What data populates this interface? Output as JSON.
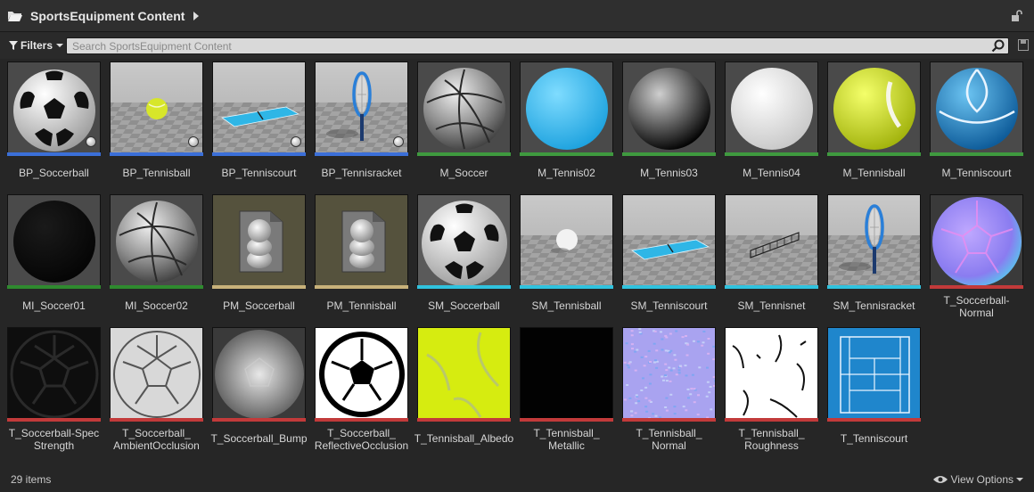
{
  "header": {
    "title": "SportsEquipment Content"
  },
  "toolbar": {
    "filters_label": "Filters",
    "search_placeholder": "Search SportsEquipment Content"
  },
  "status": {
    "item_count": "29 items",
    "view_options_label": "View Options"
  },
  "colors": {
    "blueprint": "#3b6fd8",
    "material": "#3f9a3f",
    "material_instance": "#2f8a2f",
    "physics_material": "#c8b27a",
    "static_mesh": "#30c2de",
    "texture": "#c23a3a"
  },
  "assets": [
    {
      "name": "BP_Soccerball",
      "kind": "blueprint",
      "icon": "soccer-ball"
    },
    {
      "name": "BP_Tennisball",
      "kind": "blueprint",
      "icon": "tennis-ball-scene"
    },
    {
      "name": "BP_Tenniscourt",
      "kind": "blueprint",
      "icon": "tennis-court-scene"
    },
    {
      "name": "BP_Tennisracket",
      "kind": "blueprint",
      "icon": "tennis-racket"
    },
    {
      "name": "M_Soccer",
      "kind": "material",
      "icon": "silver-ball"
    },
    {
      "name": "M_Tennis02",
      "kind": "material",
      "icon": "blue-sphere"
    },
    {
      "name": "M_Tennis03",
      "kind": "material",
      "icon": "black-sphere"
    },
    {
      "name": "M_Tennis04",
      "kind": "material",
      "icon": "white-sphere"
    },
    {
      "name": "M_Tennisball",
      "kind": "material",
      "icon": "yellow-tennis-ball"
    },
    {
      "name": "M_Tenniscourt",
      "kind": "material",
      "icon": "blue-court-sphere"
    },
    {
      "name": "MI_Soccer01",
      "kind": "material_instance",
      "icon": "dark-sphere"
    },
    {
      "name": "MI_Soccer02",
      "kind": "material_instance",
      "icon": "silver-ball"
    },
    {
      "name": "PM_Soccerball",
      "kind": "physics_material",
      "icon": "physics-material"
    },
    {
      "name": "PM_Tennisball",
      "kind": "physics_material",
      "icon": "physics-material"
    },
    {
      "name": "SM_Soccerball",
      "kind": "static_mesh",
      "icon": "soccer-ball-large"
    },
    {
      "name": "SM_Tennisball",
      "kind": "static_mesh",
      "icon": "white-ball-scene"
    },
    {
      "name": "SM_Tenniscourt",
      "kind": "static_mesh",
      "icon": "tennis-court-scene"
    },
    {
      "name": "SM_Tennisnet",
      "kind": "static_mesh",
      "icon": "tennis-net-scene"
    },
    {
      "name": "SM_Tennisracket",
      "kind": "static_mesh",
      "icon": "tennis-racket"
    },
    {
      "name": "T_Soccerball-\nNormal",
      "kind": "texture",
      "icon": "normal-map-ball"
    },
    {
      "name": "T_Soccerball-Spec\nStrength",
      "kind": "texture",
      "icon": "dark-hex-texture"
    },
    {
      "name": "T_Soccerball_\nAmbientOcclusion",
      "kind": "texture",
      "icon": "ao-hex-texture"
    },
    {
      "name": "T_Soccerball_Bump",
      "kind": "texture",
      "icon": "bump-texture"
    },
    {
      "name": "T_Soccerball_\nReflectiveOcclusion",
      "kind": "texture",
      "icon": "bw-soccer-texture"
    },
    {
      "name": "T_Tennisball_Albedo",
      "kind": "texture",
      "icon": "yellow-texture"
    },
    {
      "name": "T_Tennisball_\nMetallic",
      "kind": "texture",
      "icon": "black-texture"
    },
    {
      "name": "T_Tennisball_\nNormal",
      "kind": "texture",
      "icon": "lavender-noise-texture"
    },
    {
      "name": "T_Tennisball_\nRoughness",
      "kind": "texture",
      "icon": "white-roughness-texture"
    },
    {
      "name": "T_Tenniscourt",
      "kind": "texture",
      "icon": "court-texture"
    }
  ]
}
